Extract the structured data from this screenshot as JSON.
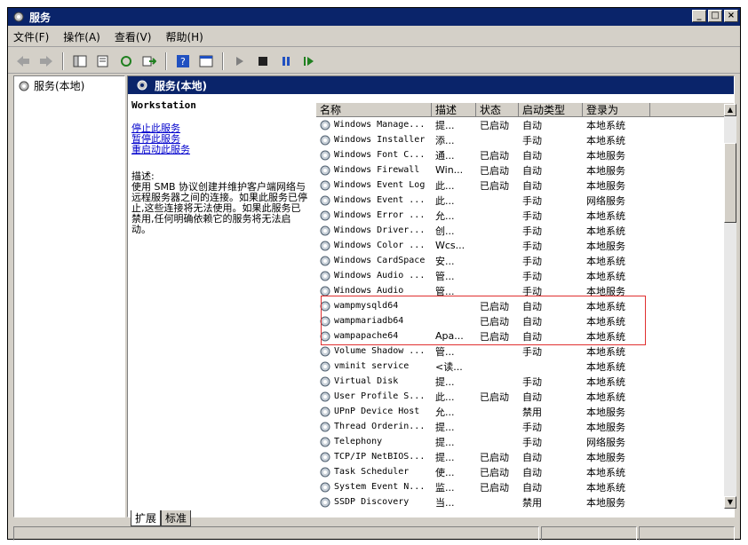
{
  "window": {
    "title": "服务"
  },
  "menu": [
    "文件(F)",
    "操作(A)",
    "查看(V)",
    "帮助(H)"
  ],
  "tree": {
    "item": "服务(本地)"
  },
  "pane_header": "服务(本地)",
  "details": {
    "service_name": "Workstation",
    "links": [
      "停止此服务",
      "暂停此服务",
      "重启动此服务"
    ],
    "desc_label": "描述:",
    "desc_text": "使用 SMB 协议创建并维护客户端网络与远程服务器之间的连接。如果此服务已停止,这些连接将无法使用。如果此服务已禁用,任何明确依赖它的服务将无法启动。"
  },
  "columns": [
    "名称",
    "描述",
    "状态",
    "启动类型",
    "登录为"
  ],
  "rows": [
    [
      "Windows Manage...",
      "提...",
      "已启动",
      "自动",
      "本地系统"
    ],
    [
      "Windows Installer",
      "添...",
      "",
      "手动",
      "本地系统"
    ],
    [
      "Windows Font C...",
      "通...",
      "已启动",
      "自动",
      "本地服务"
    ],
    [
      "Windows Firewall",
      "Win...",
      "已启动",
      "自动",
      "本地服务"
    ],
    [
      "Windows Event Log",
      "此...",
      "已启动",
      "自动",
      "本地服务"
    ],
    [
      "Windows Event ...",
      "此...",
      "",
      "手动",
      "网络服务"
    ],
    [
      "Windows Error ...",
      "允...",
      "",
      "手动",
      "本地系统"
    ],
    [
      "Windows Driver...",
      "创...",
      "",
      "手动",
      "本地系统"
    ],
    [
      "Windows Color ...",
      "Wcs...",
      "",
      "手动",
      "本地服务"
    ],
    [
      "Windows CardSpace",
      "安...",
      "",
      "手动",
      "本地系统"
    ],
    [
      "Windows Audio ...",
      "管...",
      "",
      "手动",
      "本地系统"
    ],
    [
      "Windows Audio",
      "管...",
      "",
      "手动",
      "本地服务"
    ],
    [
      "wampmysqld64",
      "",
      "已启动",
      "自动",
      "本地系统"
    ],
    [
      "wampmariadb64",
      "",
      "已启动",
      "自动",
      "本地系统"
    ],
    [
      "wampapache64",
      "Apa...",
      "已启动",
      "自动",
      "本地系统"
    ],
    [
      "Volume Shadow ...",
      "管...",
      "",
      "手动",
      "本地系统"
    ],
    [
      "vminit service",
      "<读...",
      "",
      "",
      "本地系统"
    ],
    [
      "Virtual Disk",
      "提...",
      "",
      "手动",
      "本地系统"
    ],
    [
      "User Profile S...",
      "此...",
      "已启动",
      "自动",
      "本地系统"
    ],
    [
      "UPnP Device Host",
      "允...",
      "",
      "禁用",
      "本地服务"
    ],
    [
      "Thread Orderin...",
      "提...",
      "",
      "手动",
      "本地服务"
    ],
    [
      "Telephony",
      "提...",
      "",
      "手动",
      "网络服务"
    ],
    [
      "TCP/IP NetBIOS...",
      "提...",
      "已启动",
      "自动",
      "本地服务"
    ],
    [
      "Task Scheduler",
      "使...",
      "已启动",
      "自动",
      "本地系统"
    ],
    [
      "System Event N...",
      "监...",
      "已启动",
      "自动",
      "本地系统"
    ],
    [
      "SSDP Discovery",
      "当...",
      "",
      "禁用",
      "本地服务"
    ]
  ],
  "tabs": [
    "扩展",
    "标准"
  ],
  "colors": {
    "title_bar": "#0a246a",
    "highlight_border": "#e03030",
    "link": "#0000cc"
  },
  "icons": [
    "back-icon",
    "forward-icon",
    "show-tree-icon",
    "properties-icon",
    "refresh-icon",
    "export-icon",
    "help-icon",
    "console-icon",
    "start-icon",
    "stop-icon",
    "pause-icon",
    "restart-icon",
    "service-gear-icon"
  ]
}
